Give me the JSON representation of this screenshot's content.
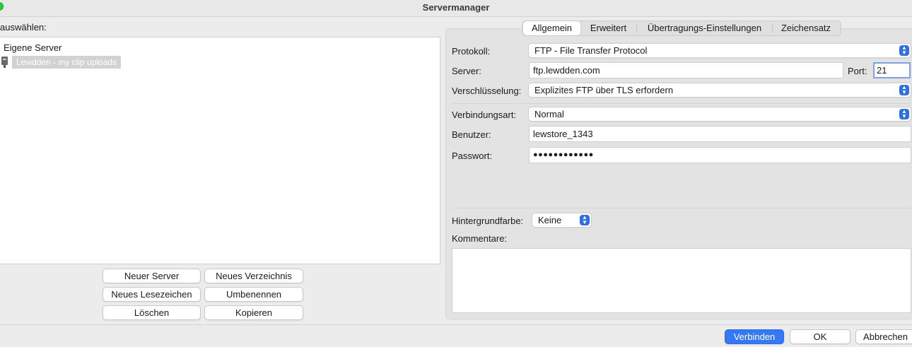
{
  "window": {
    "title": "Servermanager"
  },
  "left": {
    "select_label": "auswählen:",
    "tree": {
      "root": "Eigene Server",
      "children": [
        {
          "label": "Lewdden - my clip uploads",
          "icon": "server-icon"
        }
      ]
    },
    "buttons": {
      "new_server": "Neuer Server",
      "new_folder": "Neues Verzeichnis",
      "new_bookmark": "Neues Lesezeichen",
      "rename": "Umbenennen",
      "delete": "Löschen",
      "copy": "Kopieren"
    }
  },
  "tabs": [
    "Allgemein",
    "Erweitert",
    "Übertragungs-Einstellungen",
    "Zeichensatz"
  ],
  "general": {
    "protocol_label": "Protokoll:",
    "protocol_value": "FTP - File Transfer Protocol",
    "server_label": "Server:",
    "server_value": "ftp.lewdden.com",
    "port_label": "Port:",
    "port_value": "21",
    "encryption_label": "Verschlüsselung:",
    "encryption_value": "Explizites FTP über TLS erfordern",
    "logon_label": "Verbindungsart:",
    "logon_value": "Normal",
    "user_label": "Benutzer:",
    "user_value": "lewstore_1343",
    "password_label": "Passwort:",
    "password_value": "●●●●●●●●●●●●",
    "bg_label": "Hintergrundfarbe:",
    "bg_value": "Keine",
    "comments_label": "Kommentare:"
  },
  "footer": {
    "connect": "Verbinden",
    "ok": "OK",
    "cancel": "Abbrechen"
  },
  "colors": {
    "accent": "#3478f6",
    "selection": "#d2d2d2"
  }
}
